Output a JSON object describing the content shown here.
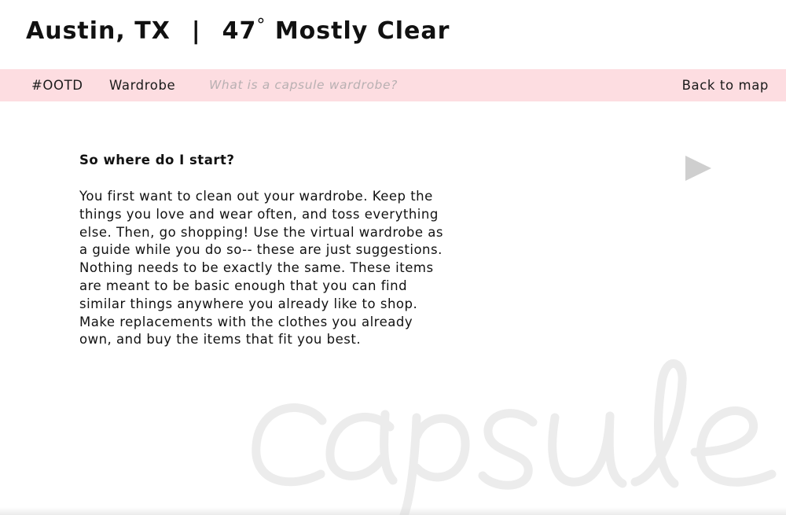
{
  "header": {
    "location": "Austin, TX",
    "separator": "|",
    "temperature": "47",
    "degree_symbol": "°",
    "condition": "Mostly Clear"
  },
  "nav": {
    "ootd_label": "#OOTD",
    "wardrobe_label": "Wardrobe",
    "capsule_question_label": "What is a capsule wardrobe?",
    "back_label": "Back to map"
  },
  "content": {
    "heading": "So where do I start?",
    "body_lines": [
      "You first want to clean out your wardrobe. Keep the",
      "things you love and wear often, and toss everything",
      "else. Then, go shopping! Use the virtual wardrobe as",
      "a guide while you do so-- these are just suggestions.",
      "Nothing needs to be exactly the same. These items",
      "are meant to be basic enough that you can find",
      "similar things anywhere you already like to shop.",
      "Make replacements with the clothes you already",
      "own, and buy the items that fit you best."
    ]
  },
  "watermark": {
    "text": "capsule"
  },
  "icons": {
    "play": "play-icon"
  },
  "colors": {
    "nav_background": "#fddde1",
    "muted_nav_text": "#b8b0b2",
    "play_icon": "#cfcfcf",
    "watermark": "#ececec"
  }
}
